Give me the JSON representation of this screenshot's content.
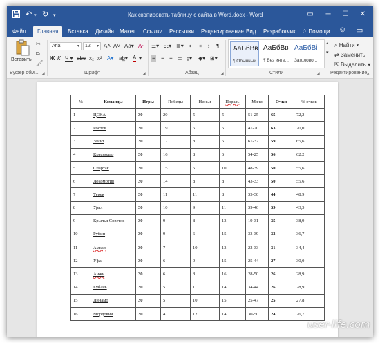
{
  "titlebar": {
    "doc_title": "Как скопировать таблицу с сайта в Word.docx - Word",
    "save_icon": "save-icon",
    "undo_icon": "undo-icon",
    "redo_icon": "redo-icon"
  },
  "tabs": [
    "Файл",
    "Главная",
    "Вставка",
    "Дизайн",
    "Макет",
    "Ссылки",
    "Рассылки",
    "Рецензирование",
    "Вид",
    "Разработчик"
  ],
  "active_tab": "Главная",
  "tell_me": "Помощи",
  "ribbon": {
    "paste_label": "Вставить",
    "font_name": "Arial",
    "font_size": "12",
    "groups": {
      "clipboard": "Буфер обм...",
      "font": "Шрифт",
      "paragraph": "Абзац",
      "styles": "Стили",
      "editing": "Редактирование"
    },
    "styles": [
      {
        "sample": "АаБбВв",
        "name": "¶ Обычный"
      },
      {
        "sample": "АаБбВв",
        "name": "¶ Без инте..."
      },
      {
        "sample": "АаБбВі",
        "name": "Заголово..."
      }
    ],
    "editing": {
      "find": "Найти",
      "replace": "Заменить",
      "select": "Выделить"
    },
    "colors": {
      "title_bar": "#2b579a",
      "highlight": "#ffff00",
      "font_color": "#c00000"
    }
  },
  "table": {
    "headers": [
      "№",
      "Команды",
      "Игры",
      "Победы",
      "Ничьи",
      "Пораж.",
      "Мячи",
      "Очки",
      "% очков"
    ],
    "rows": [
      [
        "1",
        "ЦСКА",
        "30",
        "20",
        "5",
        "5",
        "51-25",
        "65",
        "72,2"
      ],
      [
        "2",
        "Ростов",
        "30",
        "19",
        "6",
        "5",
        "41-20",
        "63",
        "70,0"
      ],
      [
        "3",
        "Зенит",
        "30",
        "17",
        "8",
        "5",
        "61-32",
        "59",
        "65,6"
      ],
      [
        "4",
        "Краснодар",
        "30",
        "16",
        "8",
        "6",
        "54-25",
        "56",
        "62,2"
      ],
      [
        "5",
        "Спартак",
        "30",
        "15",
        "5",
        "10",
        "48-39",
        "50",
        "55,6"
      ],
      [
        "6",
        "Локомотив",
        "30",
        "14",
        "8",
        "8",
        "43-33",
        "50",
        "55,6"
      ],
      [
        "7",
        "Терек",
        "30",
        "11",
        "11",
        "8",
        "35-30",
        "44",
        "48,9"
      ],
      [
        "8",
        "Урал",
        "30",
        "10",
        "9",
        "11",
        "39-46",
        "39",
        "43,3"
      ],
      [
        "9",
        "Крылья Советов",
        "30",
        "9",
        "8",
        "13",
        "19-31",
        "35",
        "38,9"
      ],
      [
        "10",
        "Рубин",
        "30",
        "9",
        "6",
        "15",
        "33-39",
        "33",
        "36,7"
      ],
      [
        "11",
        "Амкар",
        "30",
        "7",
        "10",
        "13",
        "22-33",
        "31",
        "34,4"
      ],
      [
        "12",
        "Уфа",
        "30",
        "6",
        "9",
        "15",
        "25-44",
        "27",
        "30,0"
      ],
      [
        "13",
        "Анжи",
        "30",
        "6",
        "8",
        "16",
        "28-50",
        "26",
        "28,9"
      ],
      [
        "14",
        "Кубань",
        "30",
        "5",
        "11",
        "14",
        "34-44",
        "26",
        "28,9"
      ],
      [
        "15",
        "Динамо",
        "30",
        "5",
        "10",
        "15",
        "25-47",
        "25",
        "27,8"
      ],
      [
        "16",
        "Мордовия",
        "30",
        "4",
        "12",
        "14",
        "30-50",
        "24",
        "26,7"
      ]
    ]
  },
  "watermark": "user-life.com"
}
